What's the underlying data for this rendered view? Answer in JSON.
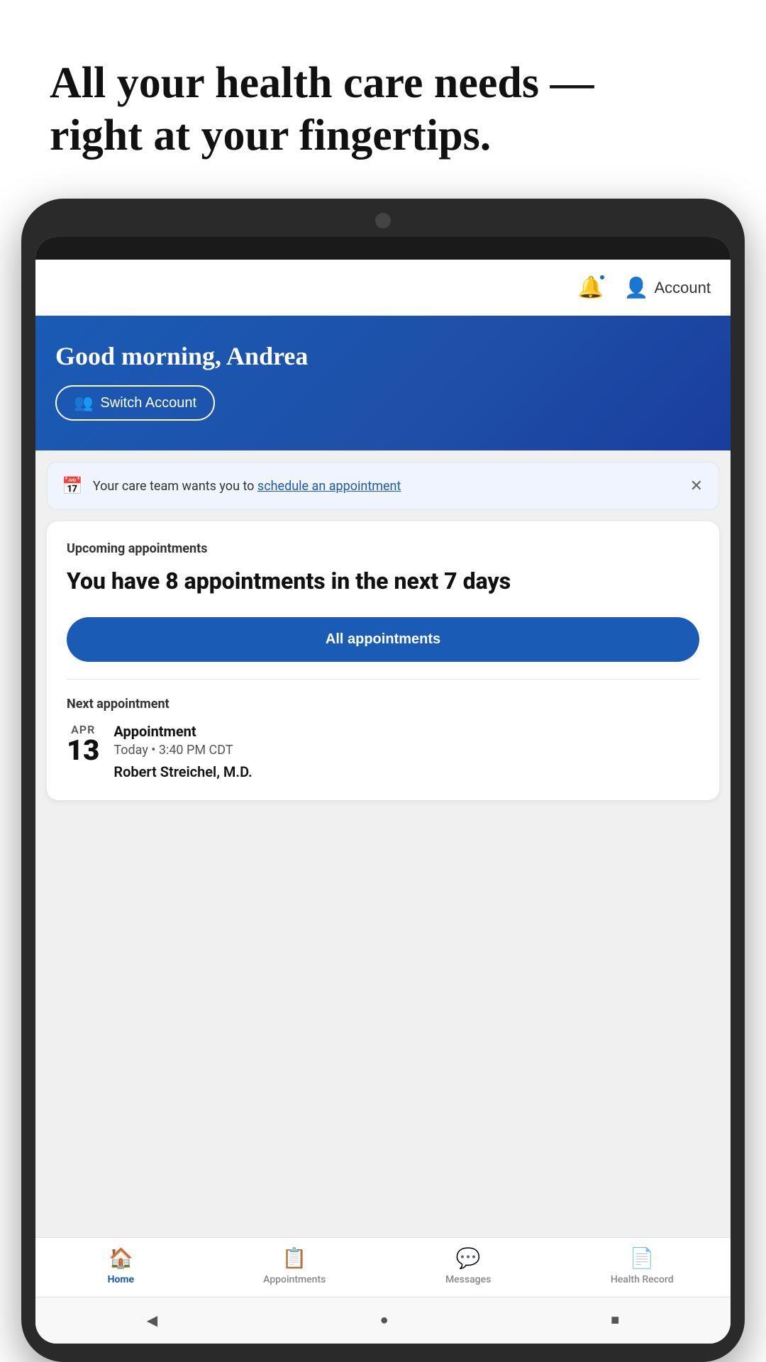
{
  "hero": {
    "line1": "All your health care needs —",
    "line2": "right at your fingertips."
  },
  "header": {
    "account_label": "Account"
  },
  "banner": {
    "greeting": "Good morning, Andrea",
    "switch_account_label": "Switch Account"
  },
  "care_notice": {
    "text_before": "Your care team wants you to ",
    "link_text": "schedule an appointment"
  },
  "appointments_card": {
    "subtitle": "Upcoming appointments",
    "title": "You have 8 appointments in the next 7 days",
    "all_btn_label": "All appointments",
    "next_label": "Next appointment",
    "next_month": "APR",
    "next_day": "13",
    "next_type": "Appointment",
    "next_time": "Today • 3:40 PM CDT",
    "next_doctor": "Robert Streichel, M.D."
  },
  "nav": {
    "home": "Home",
    "appointments": "Appointments",
    "messages": "Messages",
    "health_record": "Health Record"
  }
}
